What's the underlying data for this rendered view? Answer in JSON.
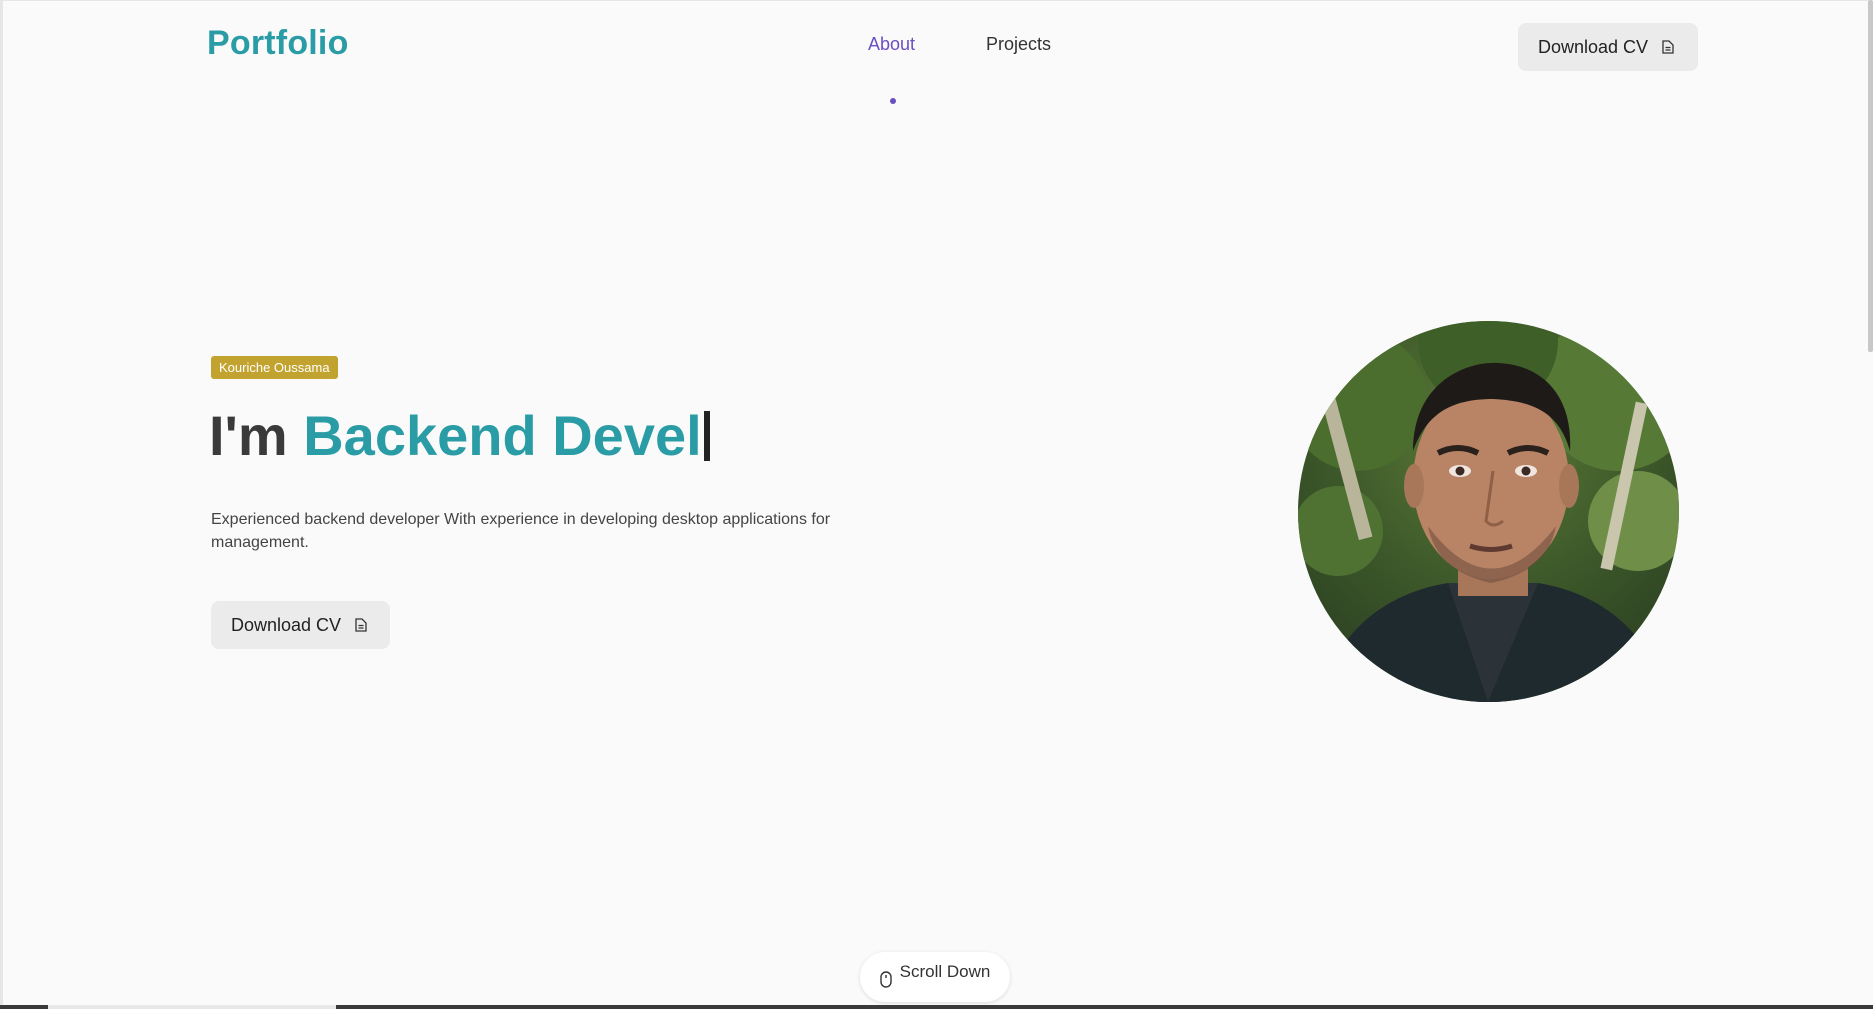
{
  "header": {
    "logo": "Portfolio",
    "nav": [
      {
        "label": "About",
        "active": true
      },
      {
        "label": "Projects",
        "active": false
      }
    ],
    "download_label": "Download CV"
  },
  "hero": {
    "badge": "Kouriche Oussama",
    "headline_prefix": "I'm ",
    "headline_role": "Backend Devel",
    "description": "Experienced backend developer With experience in developing desktop applications for management.",
    "download_label": "Download CV"
  },
  "scroll": {
    "label": "Scroll Down",
    "icon": "mouse-icon"
  },
  "colors": {
    "accent": "#2a9ca5",
    "nav_active": "#6a4fc2",
    "badge": "#c3a330",
    "background": "#fafafa"
  }
}
